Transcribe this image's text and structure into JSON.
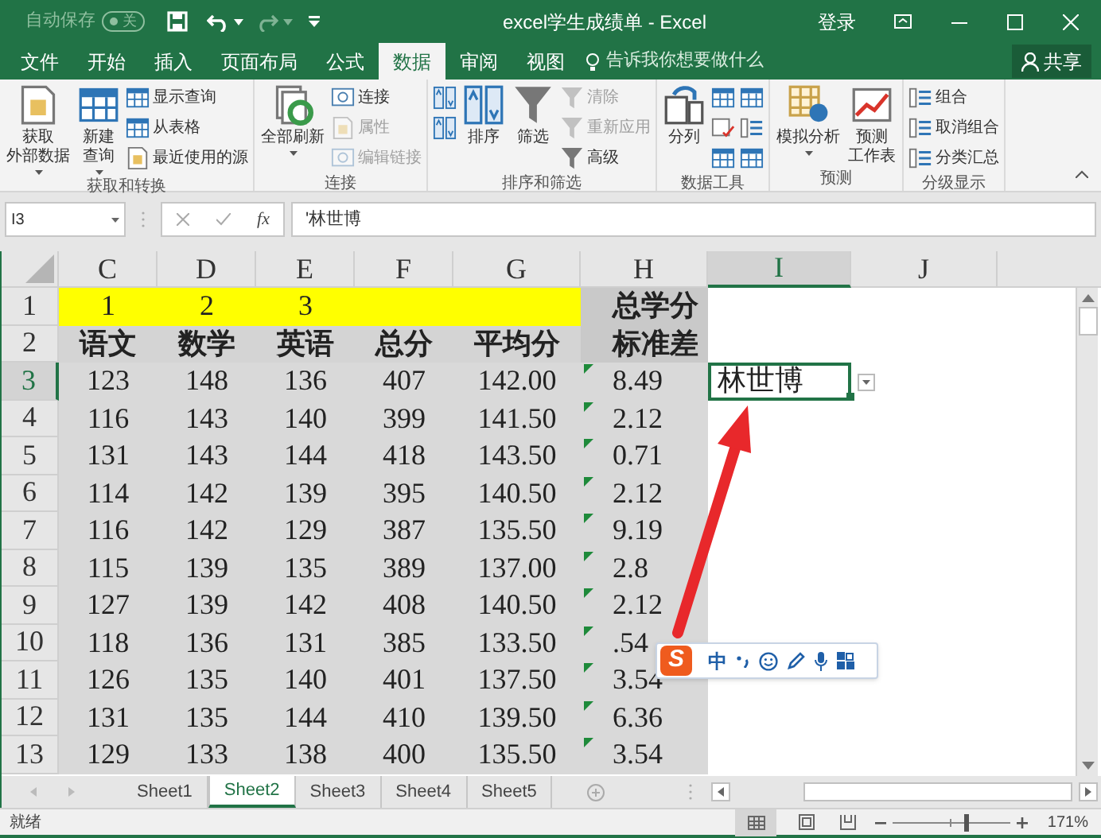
{
  "title_bar": {
    "autosave_label": "自动保存",
    "autosave_toggle": {
      "label": "关",
      "on": false
    },
    "title": "excel学生成绩单 - Excel",
    "sign_in": "登录"
  },
  "tabs": [
    {
      "label": "文件",
      "selected": false
    },
    {
      "label": "开始",
      "selected": false
    },
    {
      "label": "插入",
      "selected": false
    },
    {
      "label": "页面布局",
      "selected": false
    },
    {
      "label": "公式",
      "selected": false
    },
    {
      "label": "数据",
      "selected": true
    },
    {
      "label": "审阅",
      "selected": false
    },
    {
      "label": "视图",
      "selected": false
    }
  ],
  "tell_me": "告诉我你想要做什么",
  "share": "共享",
  "ribbon": [
    {
      "label": "获取和转换",
      "items": [
        {
          "kind": "large",
          "lines": [
            "获取",
            "外部数据"
          ],
          "dropdown": true,
          "disabled": false
        },
        {
          "kind": "large",
          "lines": [
            "新建",
            "查询"
          ],
          "dropdown": true,
          "disabled": false
        },
        {
          "kind": "small",
          "label": "显示查询",
          "disabled": false
        },
        {
          "kind": "small",
          "label": "从表格",
          "disabled": false
        },
        {
          "kind": "small",
          "label": "最近使用的源",
          "disabled": false
        }
      ]
    },
    {
      "label": "连接",
      "items": [
        {
          "kind": "large",
          "lines": [
            "全部刷新"
          ],
          "dropdown": true,
          "disabled": false
        },
        {
          "kind": "small",
          "label": "连接",
          "disabled": false
        },
        {
          "kind": "small",
          "label": "属性",
          "disabled": true
        },
        {
          "kind": "small",
          "label": "编辑链接",
          "disabled": true
        }
      ]
    },
    {
      "label": "排序和筛选",
      "items": [
        {
          "kind": "icon",
          "disabled": false
        },
        {
          "kind": "icon",
          "disabled": false
        },
        {
          "kind": "large",
          "lines": [
            "排序"
          ],
          "dropdown": false,
          "disabled": false
        },
        {
          "kind": "large",
          "lines": [
            "筛选"
          ],
          "dropdown": false,
          "disabled": false
        },
        {
          "kind": "small",
          "label": "清除",
          "disabled": true
        },
        {
          "kind": "small",
          "label": "重新应用",
          "disabled": true
        },
        {
          "kind": "small",
          "label": "高级",
          "disabled": false
        }
      ]
    },
    {
      "label": "数据工具",
      "items": [
        {
          "kind": "large",
          "lines": [
            "分列"
          ],
          "dropdown": false,
          "disabled": false
        },
        {
          "kind": "icon",
          "disabled": false
        },
        {
          "kind": "icon",
          "disabled": false
        },
        {
          "kind": "icon",
          "disabled": false
        },
        {
          "kind": "icon",
          "disabled": false
        },
        {
          "kind": "icon",
          "disabled": false
        },
        {
          "kind": "icon",
          "disabled": false
        }
      ]
    },
    {
      "label": "预测",
      "items": [
        {
          "kind": "large",
          "lines": [
            "模拟分析"
          ],
          "dropdown": true,
          "disabled": false
        },
        {
          "kind": "large",
          "lines": [
            "预测",
            "工作表"
          ],
          "dropdown": false,
          "disabled": false
        }
      ]
    },
    {
      "label": "分级显示",
      "items": [
        {
          "kind": "small",
          "label": "组合",
          "disabled": false
        },
        {
          "kind": "small",
          "label": "取消组合",
          "disabled": false
        },
        {
          "kind": "small",
          "label": "分类汇总",
          "disabled": false
        }
      ]
    }
  ],
  "formula_bar": {
    "name_box": "I3",
    "function_label": "fx",
    "formula": "'林世博"
  },
  "columns": [
    {
      "label": "C",
      "selected": false
    },
    {
      "label": "D",
      "selected": false
    },
    {
      "label": "E",
      "selected": false
    },
    {
      "label": "F",
      "selected": false
    },
    {
      "label": "G",
      "selected": false
    },
    {
      "label": "H",
      "selected": false
    },
    {
      "label": "I",
      "selected": true
    },
    {
      "label": "J",
      "selected": false
    }
  ],
  "rows": [
    {
      "number": "1",
      "selected": false,
      "kind": "marker",
      "error_flag": false,
      "cells": [
        "1",
        "2",
        "3",
        null,
        null,
        "总学分",
        null,
        null
      ]
    },
    {
      "number": "2",
      "selected": false,
      "kind": "header",
      "error_flag": false,
      "cells": [
        "语文",
        "数学",
        "英语",
        "总分",
        "平均分",
        "标准差",
        null,
        null
      ]
    },
    {
      "number": "3",
      "selected": true,
      "kind": "data",
      "error_flag": true,
      "cells": [
        "123",
        "148",
        "136",
        "407",
        "142.00",
        "8.49",
        "林世博",
        null
      ]
    },
    {
      "number": "4",
      "selected": false,
      "kind": "data",
      "error_flag": true,
      "cells": [
        "116",
        "143",
        "140",
        "399",
        "141.50",
        "2.12",
        null,
        null
      ]
    },
    {
      "number": "5",
      "selected": false,
      "kind": "data",
      "error_flag": true,
      "cells": [
        "131",
        "143",
        "144",
        "418",
        "143.50",
        "0.71",
        null,
        null
      ]
    },
    {
      "number": "6",
      "selected": false,
      "kind": "data",
      "error_flag": true,
      "cells": [
        "114",
        "142",
        "139",
        "395",
        "140.50",
        "2.12",
        null,
        null
      ]
    },
    {
      "number": "7",
      "selected": false,
      "kind": "data",
      "error_flag": true,
      "cells": [
        "116",
        "142",
        "129",
        "387",
        "135.50",
        "9.19",
        null,
        null
      ]
    },
    {
      "number": "8",
      "selected": false,
      "kind": "data",
      "error_flag": true,
      "cells": [
        "115",
        "139",
        "135",
        "389",
        "137.00",
        "2.8",
        null,
        null
      ]
    },
    {
      "number": "9",
      "selected": false,
      "kind": "data",
      "error_flag": true,
      "cells": [
        "127",
        "139",
        "142",
        "408",
        "140.50",
        "2.12",
        null,
        null
      ]
    },
    {
      "number": "10",
      "selected": false,
      "kind": "data",
      "error_flag": true,
      "cells": [
        "118",
        "136",
        "131",
        "385",
        "133.50",
        ".54",
        null,
        null
      ]
    },
    {
      "number": "11",
      "selected": false,
      "kind": "data",
      "error_flag": true,
      "cells": [
        "126",
        "135",
        "140",
        "401",
        "137.50",
        "3.54",
        null,
        null
      ]
    },
    {
      "number": "12",
      "selected": false,
      "kind": "data",
      "error_flag": true,
      "cells": [
        "131",
        "135",
        "144",
        "410",
        "139.50",
        "6.36",
        null,
        null
      ]
    },
    {
      "number": "13",
      "selected": false,
      "kind": "data",
      "error_flag": true,
      "cells": [
        "129",
        "133",
        "138",
        "400",
        "135.50",
        "3.54",
        null,
        null
      ]
    }
  ],
  "sheets": [
    {
      "label": "Sheet1",
      "selected": false
    },
    {
      "label": "Sheet2",
      "selected": true
    },
    {
      "label": "Sheet3",
      "selected": false
    },
    {
      "label": "Sheet4",
      "selected": false
    },
    {
      "label": "Sheet5",
      "selected": false
    }
  ],
  "status": "就绪",
  "zoom": {
    "level": 0.62,
    "reading": "171%"
  },
  "ime": {
    "logo": "S",
    "mode": "中"
  }
}
